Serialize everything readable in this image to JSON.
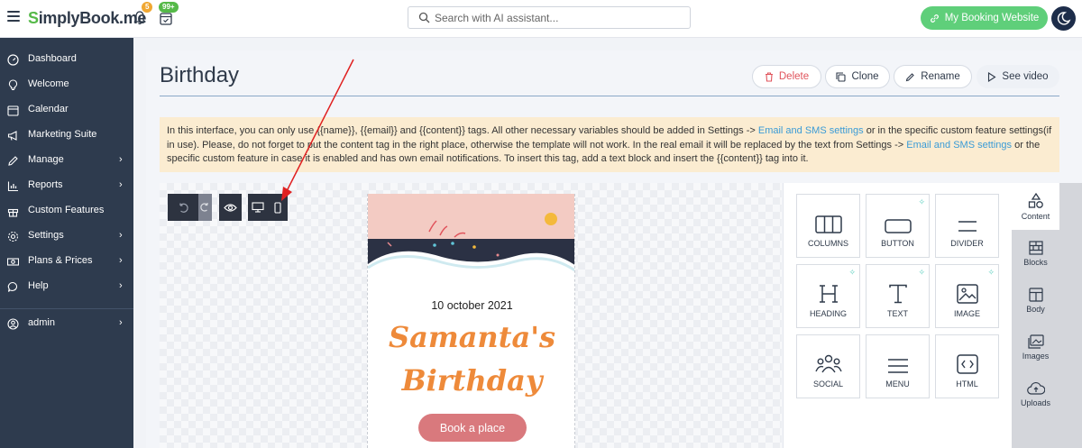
{
  "header": {
    "logo": "implyBook.me",
    "logo_initial": "S",
    "bell_count": "5",
    "calendar_count": "99+",
    "search_placeholder": "Search with AI assistant...",
    "booking_button": "My Booking Website",
    "accent_color": "#5fcf7a"
  },
  "sidebar": {
    "items": [
      {
        "label": "Dashboard",
        "icon": "dashboard-icon",
        "chevron": ""
      },
      {
        "label": "Welcome",
        "icon": "lightbulb-icon",
        "chevron": ""
      },
      {
        "label": "Calendar",
        "icon": "calendar-icon",
        "chevron": ""
      },
      {
        "label": "Marketing Suite",
        "icon": "megaphone-icon",
        "chevron": ""
      },
      {
        "label": "Manage",
        "icon": "pencil-icon",
        "chevron": "›"
      },
      {
        "label": "Reports",
        "icon": "chart-icon",
        "chevron": "›"
      },
      {
        "label": "Custom Features",
        "icon": "gift-icon",
        "chevron": ""
      },
      {
        "label": "Settings",
        "icon": "gear-icon",
        "chevron": "›"
      },
      {
        "label": "Plans & Prices",
        "icon": "money-icon",
        "chevron": "›"
      },
      {
        "label": "Help",
        "icon": "chat-icon",
        "chevron": "›"
      },
      {
        "label": "admin",
        "icon": "user-icon",
        "chevron": "›"
      }
    ]
  },
  "page": {
    "title": "Birthday",
    "actions": {
      "delete": "Delete",
      "clone": "Clone",
      "rename": "Rename",
      "video": "See video"
    }
  },
  "notice": {
    "part1": "In this interface, you can only use {{name}}, {{email}} and {{content}} tags. All other necessary variables should be added in Settings -> ",
    "link1": "Email and SMS settings",
    "part2": " or in the specific custom feature settings(if in use). Please, do not forget to put the content tag in the right place, otherwise the template will not work. In the real email it will be replaced by the text from Settings -> ",
    "link2": "Email and SMS settings",
    "part3": " or the specific custom feature in case it is enabled and has own email notifications. To insert this tag, add a text block and insert the {{content}} tag into it."
  },
  "email": {
    "date": "10 october 2021",
    "name": "Samanta's",
    "heading": "Birthday",
    "button": "Book a place"
  },
  "content_panel": {
    "tiles": [
      {
        "label": "COLUMNS",
        "icon": "columns-icon",
        "sparkle": false
      },
      {
        "label": "BUTTON",
        "icon": "button-icon",
        "sparkle": true
      },
      {
        "label": "DIVIDER",
        "icon": "divider-icon",
        "sparkle": false
      },
      {
        "label": "HEADING",
        "icon": "heading-icon",
        "sparkle": true
      },
      {
        "label": "TEXT",
        "icon": "text-icon",
        "sparkle": true
      },
      {
        "label": "IMAGE",
        "icon": "image-icon",
        "sparkle": true
      },
      {
        "label": "SOCIAL",
        "icon": "social-icon",
        "sparkle": false
      },
      {
        "label": "MENU",
        "icon": "menu-icon",
        "sparkle": false
      },
      {
        "label": "HTML",
        "icon": "html-icon",
        "sparkle": false
      }
    ]
  },
  "side_tabs": [
    {
      "label": "Content",
      "icon": "shapes-icon",
      "active": true
    },
    {
      "label": "Blocks",
      "icon": "blocks-icon",
      "active": false
    },
    {
      "label": "Body",
      "icon": "body-icon",
      "active": false
    },
    {
      "label": "Images",
      "icon": "images-icon",
      "active": false
    },
    {
      "label": "Uploads",
      "icon": "cloud-upload-icon",
      "active": false
    }
  ]
}
